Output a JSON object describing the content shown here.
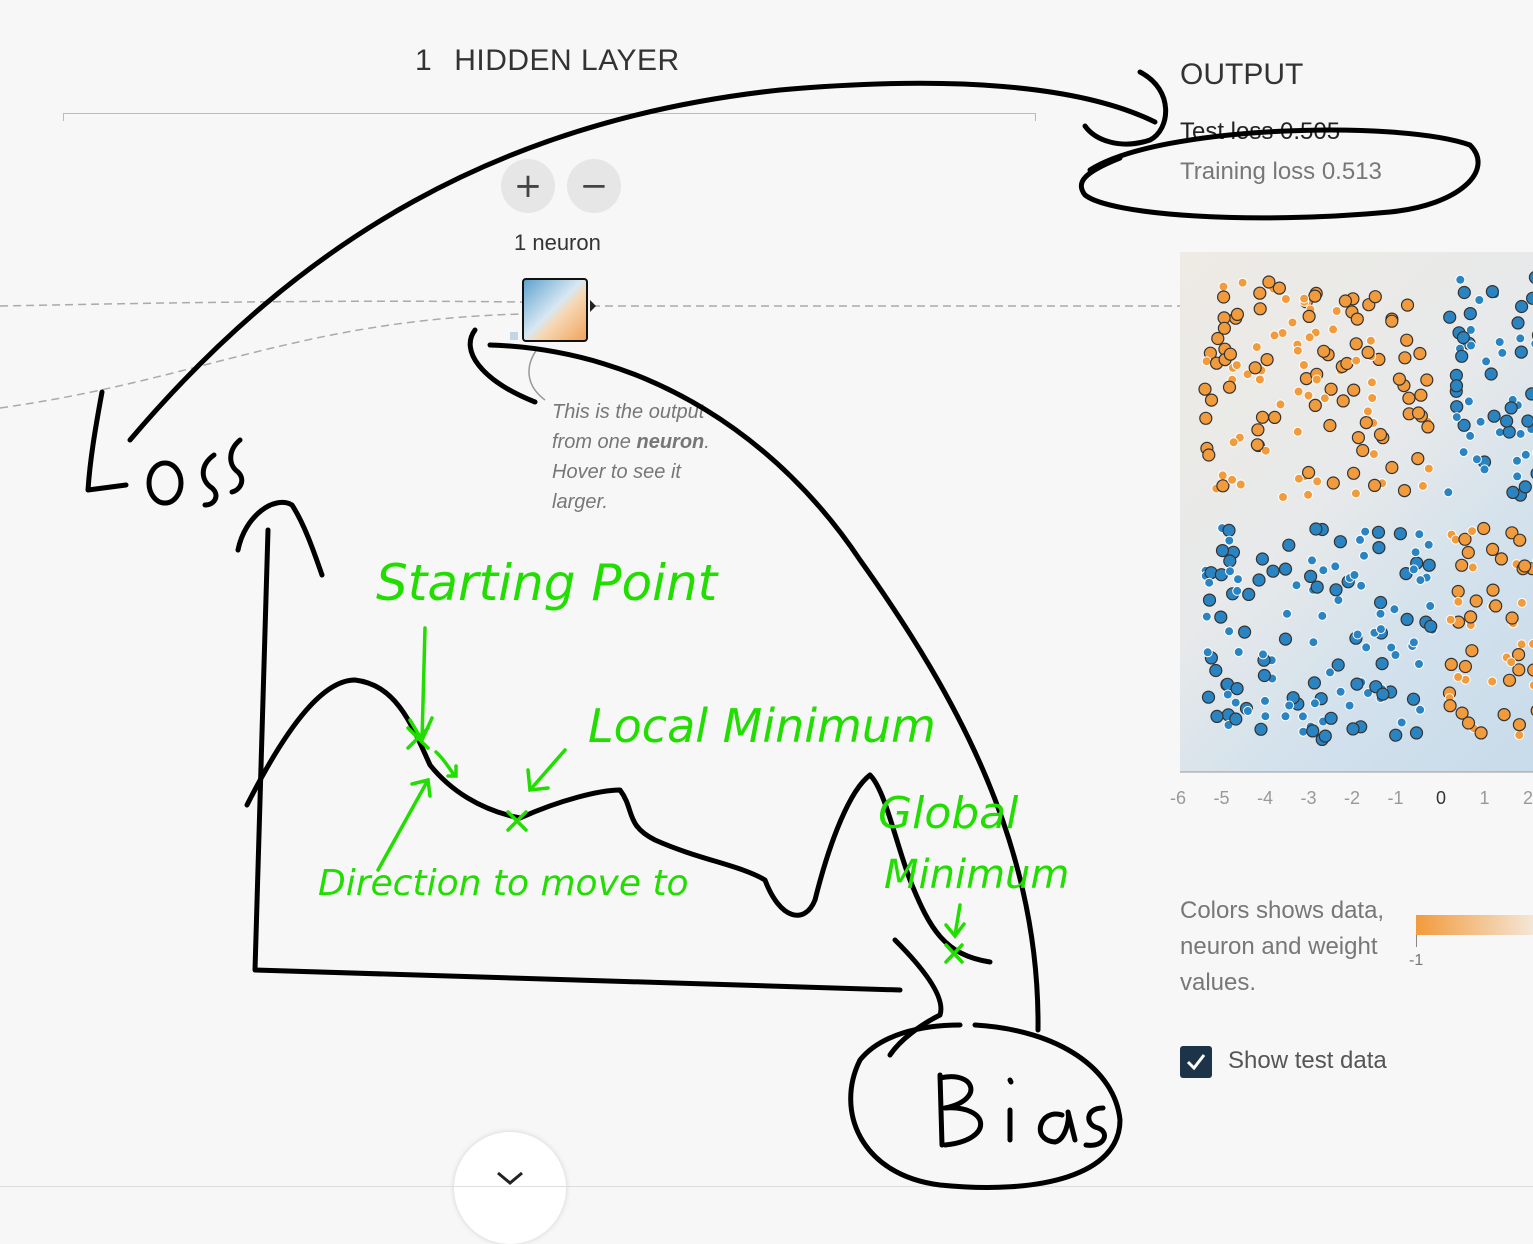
{
  "hidden_layer": {
    "count": "1",
    "label": "HIDDEN LAYER",
    "add_label": "+",
    "remove_label": "−",
    "neuron_count": "1 neuron"
  },
  "hint": {
    "prefix": "This is the output from one ",
    "bold": "neuron",
    "suffix": ". Hover to see it larger."
  },
  "output": {
    "title": "OUTPUT",
    "test_loss": "Test loss 0.505",
    "training_loss": "Training loss 0.513"
  },
  "axis_ticks": [
    "-6",
    "-5",
    "-4",
    "-3",
    "-2",
    "-1",
    "0",
    "1",
    "2"
  ],
  "legend": {
    "text": "Colors shows data, neuron and weight values.",
    "min": "-1"
  },
  "show_test": {
    "label": "Show test data",
    "checked": true
  },
  "annotations": {
    "loss": "Loss",
    "starting_point": "Starting Point",
    "local_minimum": "Local Minimum",
    "direction": "Direction to move to",
    "global_minimum_1": "Global",
    "global_minimum_2": "Minimum",
    "bias": "Bias"
  },
  "colors": {
    "orange": "#f29b3c",
    "blue": "#2b84c2",
    "ink": "#000000",
    "green": "#22dd00",
    "accent_dark": "#1d3448"
  }
}
